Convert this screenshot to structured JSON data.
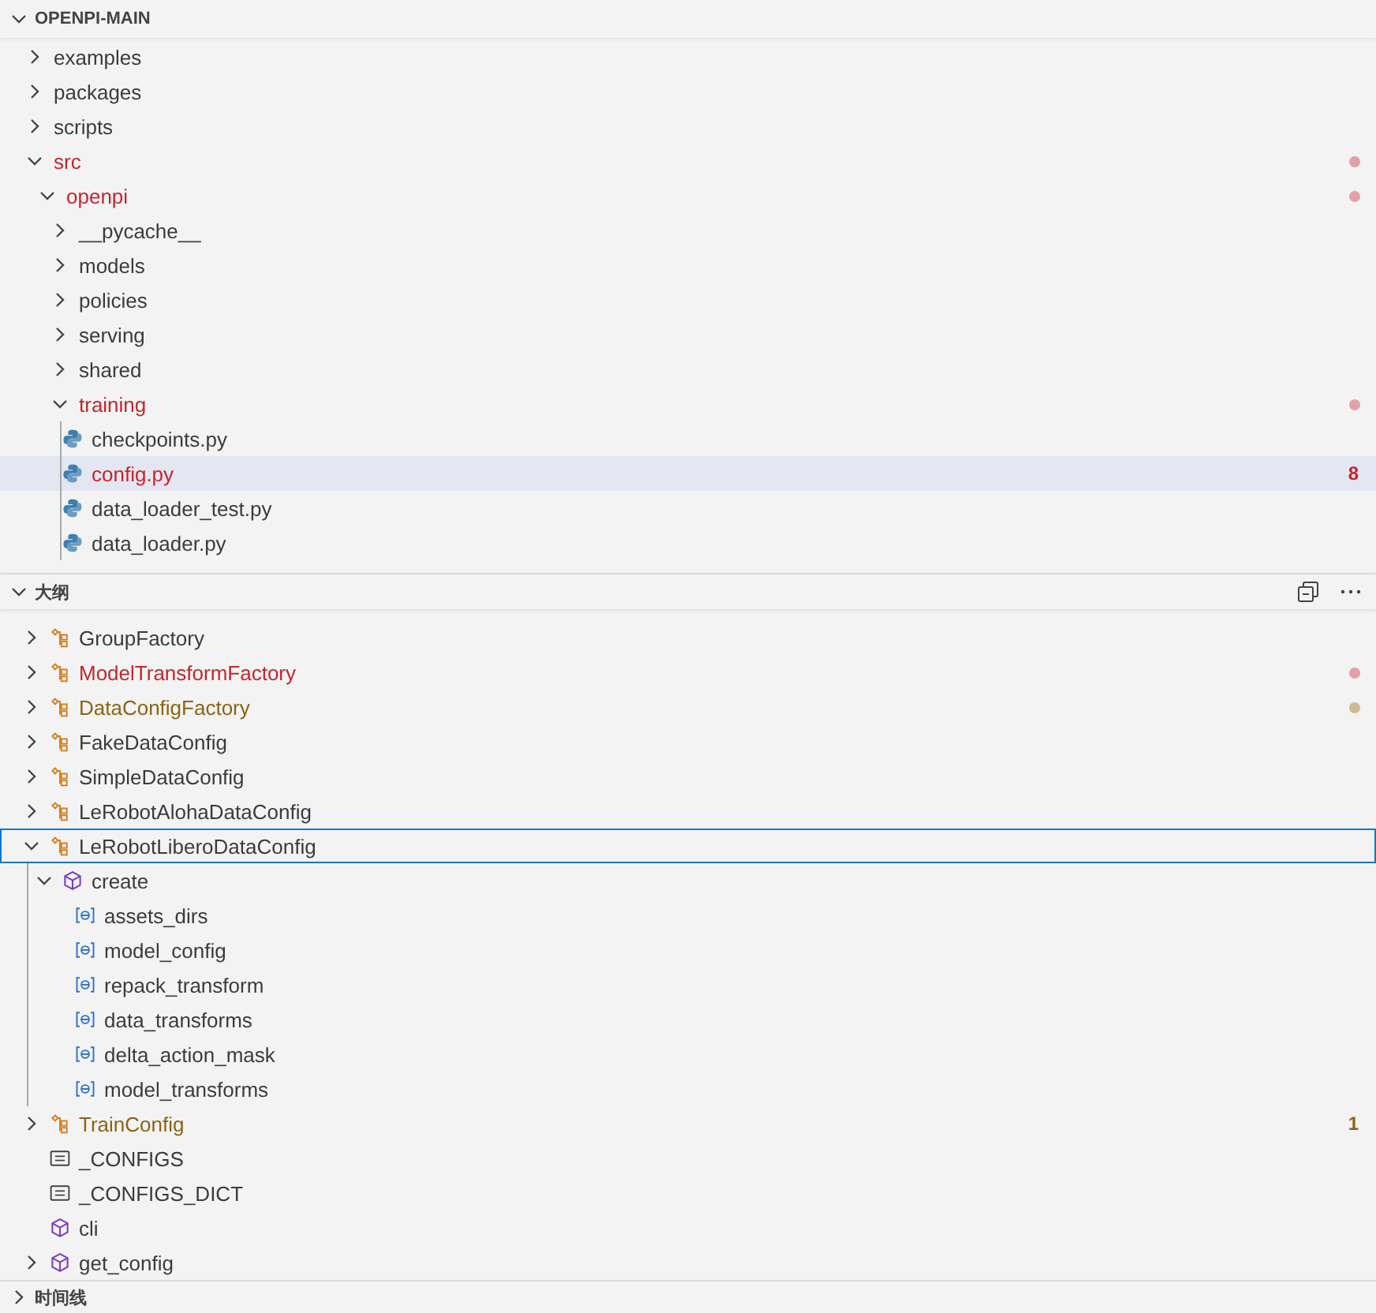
{
  "explorer": {
    "title": "OPENPI-MAIN",
    "expanded": true,
    "items": [
      {
        "label": "examples",
        "kind": "folder",
        "expanded": false
      },
      {
        "label": "packages",
        "kind": "folder",
        "expanded": false
      },
      {
        "label": "scripts",
        "kind": "folder",
        "expanded": false
      },
      {
        "label": "src",
        "kind": "folder",
        "expanded": true,
        "color": "#e0a2a8",
        "children": [
          {
            "label": "openpi",
            "kind": "folder",
            "expanded": true,
            "color": "#e0a2a8",
            "children": [
              {
                "label": "__pycache__",
                "kind": "folder",
                "expanded": false
              },
              {
                "label": "models",
                "kind": "folder",
                "expanded": false
              },
              {
                "label": "policies",
                "kind": "folder",
                "expanded": false
              },
              {
                "label": "serving",
                "kind": "folder",
                "expanded": false
              },
              {
                "label": "shared",
                "kind": "folder",
                "expanded": false
              },
              {
                "label": "training",
                "kind": "folder",
                "expanded": true,
                "color": "#e0a2a8",
                "children": [
                  {
                    "label": "checkpoints.py",
                    "kind": "file",
                    "selected": false
                  },
                  {
                    "label": "config.py",
                    "kind": "file",
                    "selected": true,
                    "color": "#c4262e",
                    "badge": "8"
                  },
                  {
                    "label": "data_loader_test.py",
                    "kind": "file",
                    "selected": false
                  },
                  {
                    "label": "data_loader.py",
                    "kind": "file",
                    "selected": false
                  }
                ]
              }
            ]
          }
        ]
      }
    ]
  },
  "outline": {
    "title": "大纲",
    "expanded": true,
    "items": [
      {
        "label": "GroupFactory",
        "kind": "class",
        "expanded": false,
        "selected": false
      },
      {
        "label": "ModelTransformFactory",
        "kind": "class",
        "expanded": false,
        "selected": false,
        "color": "#e0a2a8"
      },
      {
        "label": "DataConfigFactory",
        "kind": "class",
        "expanded": false,
        "selected": false,
        "color": "#cdb994"
      },
      {
        "label": "FakeDataConfig",
        "kind": "class",
        "expanded": false,
        "selected": false
      },
      {
        "label": "SimpleDataConfig",
        "kind": "class",
        "expanded": false,
        "selected": false
      },
      {
        "label": "LeRobotAlohaDataConfig",
        "kind": "class",
        "expanded": false,
        "selected": false
      },
      {
        "label": "LeRobotLiberoDataConfig",
        "kind": "class",
        "expanded": true,
        "selected": true,
        "children": [
          {
            "label": "create",
            "kind": "method",
            "expanded": true,
            "selected": false,
            "children": [
              {
                "label": "assets_dirs",
                "kind": "field",
                "selected": false
              },
              {
                "label": "model_config",
                "kind": "field",
                "selected": false
              },
              {
                "label": "repack_transform",
                "kind": "field",
                "selected": false
              },
              {
                "label": "data_transforms",
                "kind": "field",
                "selected": false
              },
              {
                "label": "delta_action_mask",
                "kind": "field",
                "selected": false
              },
              {
                "label": "model_transforms",
                "kind": "field",
                "selected": false
              }
            ]
          }
        ]
      },
      {
        "label": "TrainConfig",
        "kind": "class",
        "expanded": false,
        "selected": false,
        "color": "#8a6414",
        "badge": "1"
      },
      {
        "label": "_CONFIGS",
        "kind": "constant",
        "selected": false
      },
      {
        "label": "_CONFIGS_DICT",
        "kind": "constant",
        "selected": false
      },
      {
        "label": "cli",
        "kind": "method",
        "selected": false
      },
      {
        "label": "get_config",
        "kind": "method",
        "expanded": false,
        "selected": false
      }
    ]
  },
  "timeline": {
    "title": "时间线",
    "expanded": false
  }
}
